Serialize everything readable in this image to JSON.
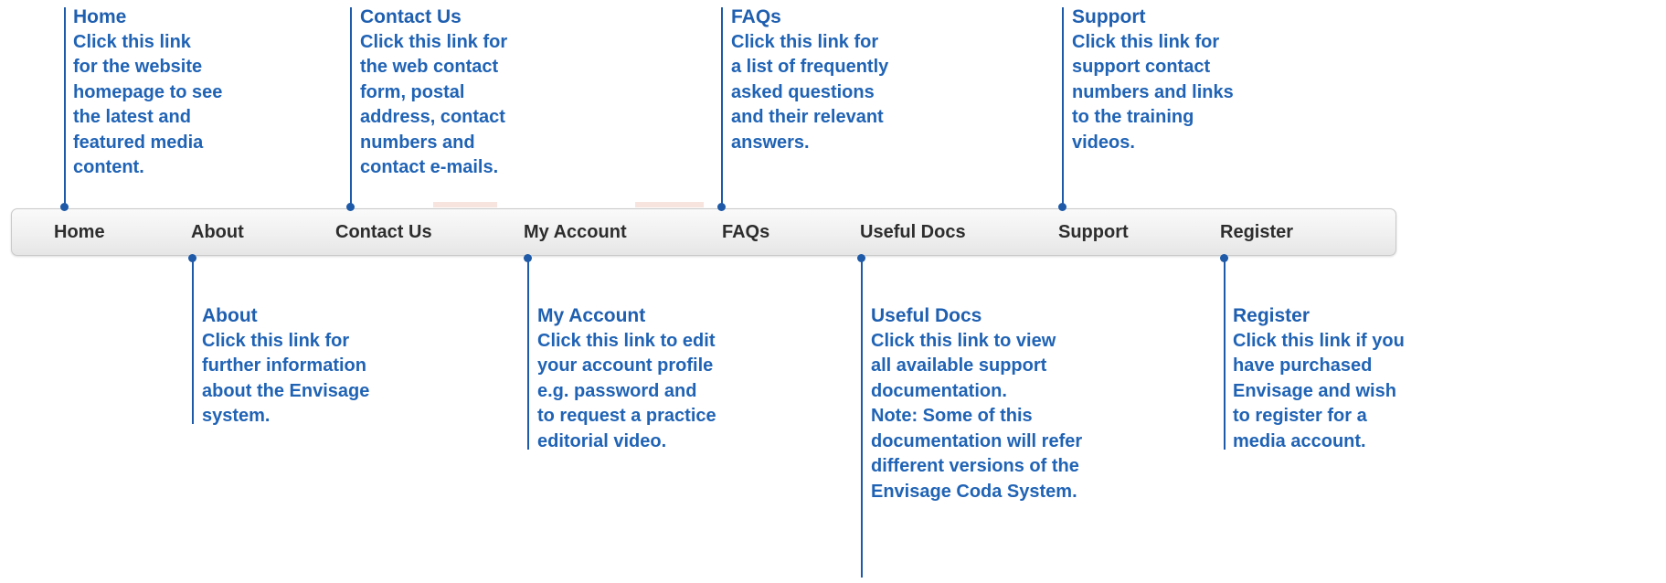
{
  "nav": {
    "items": [
      {
        "key": "home",
        "label": "Home"
      },
      {
        "key": "about",
        "label": "About"
      },
      {
        "key": "contact",
        "label": "Contact Us"
      },
      {
        "key": "account",
        "label": "My Account"
      },
      {
        "key": "faqs",
        "label": "FAQs"
      },
      {
        "key": "docs",
        "label": "Useful Docs"
      },
      {
        "key": "support",
        "label": "Support"
      },
      {
        "key": "register",
        "label": "Register"
      }
    ]
  },
  "callouts": {
    "home": {
      "title": "Home",
      "lines": [
        "Click this link",
        "for the website",
        "homepage to see",
        "the latest and",
        "featured media",
        "content."
      ]
    },
    "contact": {
      "title": "Contact Us",
      "lines": [
        "Click this link for",
        "the web contact",
        "form, postal",
        "address, contact",
        "numbers and",
        "contact e-mails."
      ]
    },
    "faqs": {
      "title": "FAQs",
      "lines": [
        "Click this link for",
        "a list of frequently",
        "asked questions",
        "and their relevant",
        "answers."
      ]
    },
    "support": {
      "title": "Support",
      "lines": [
        "Click this link for",
        "support contact",
        "numbers and links",
        "to the training",
        "videos."
      ]
    },
    "about": {
      "title": "About",
      "lines": [
        "Click this link for",
        "further information",
        "about the Envisage",
        "system."
      ]
    },
    "account": {
      "title": "My Account",
      "lines": [
        "Click this link to edit",
        "your account profile",
        "e.g. password and",
        "to request a practice",
        "editorial video."
      ]
    },
    "docs": {
      "title": "Useful Docs",
      "lines": [
        "Click this link to view",
        "all available support",
        "documentation."
      ],
      "note_label": "Note:",
      "note_first": " Some of this",
      "note_lines": [
        "documentation will refer",
        "different versions of the",
        "Envisage Coda System."
      ]
    },
    "register": {
      "title": "Register",
      "lines": [
        "Click this link if you",
        "have purchased",
        "Envisage and wish",
        "to register for a",
        "media account."
      ]
    }
  },
  "colors": {
    "annotation_blue": "#1e5aa8",
    "nav_text": "#2d2d2d"
  }
}
